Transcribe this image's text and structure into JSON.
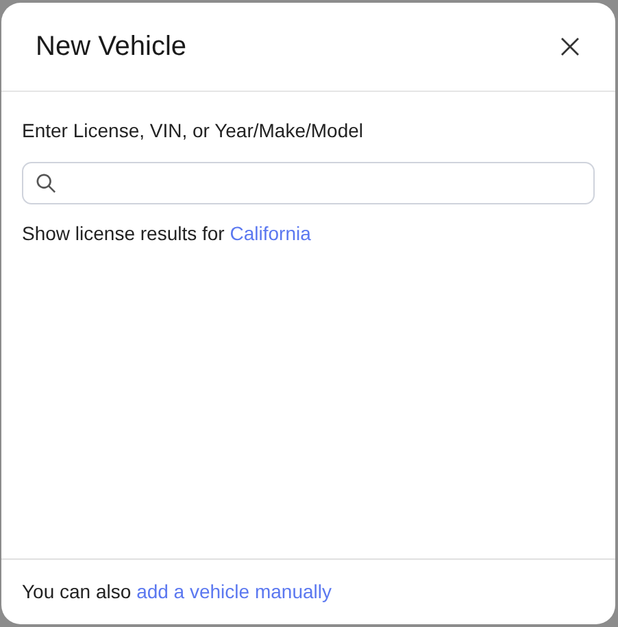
{
  "dialog": {
    "title": "New Vehicle",
    "search": {
      "label": "Enter License, VIN, or Year/Make/Model"
    },
    "license_hint": {
      "text": "Show license results for",
      "link": "California"
    },
    "footer": {
      "text": "You can also",
      "link": "add a vehicle manually"
    }
  }
}
